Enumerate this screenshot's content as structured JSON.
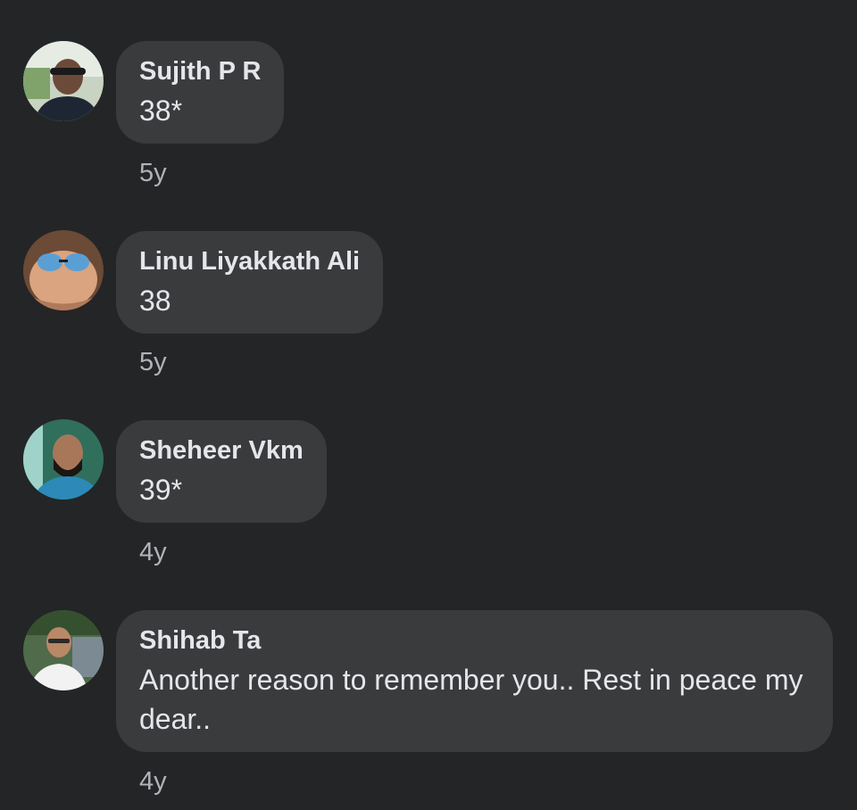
{
  "comments": [
    {
      "author": "Sujith P R",
      "text": "38*",
      "time": "5y",
      "avatar_icon": "profile-photo-avatar"
    },
    {
      "author": "Linu Liyakkath Ali",
      "text": "38",
      "time": "5y",
      "avatar_icon": "profile-photo-avatar"
    },
    {
      "author": "Sheheer Vkm",
      "text": "39*",
      "time": "4y",
      "avatar_icon": "profile-photo-avatar"
    },
    {
      "author": "Shihab Ta",
      "text": "Another reason to remember you.. Rest in peace my dear..",
      "time": "4y",
      "avatar_icon": "profile-photo-avatar"
    }
  ],
  "colors": {
    "background": "#242526",
    "bubble": "#3a3b3c",
    "primary_text": "#e4e6eb",
    "secondary_text": "#b0b3b8"
  }
}
